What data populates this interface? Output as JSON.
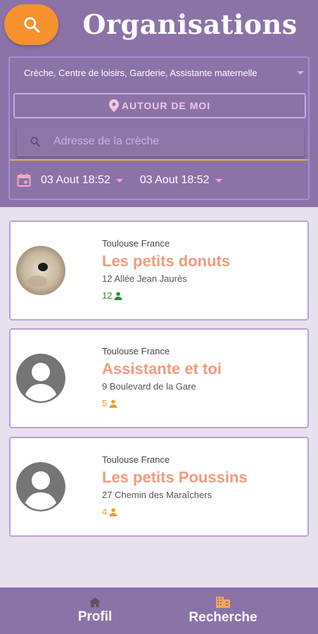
{
  "header": {
    "title": "Organisations",
    "search_icon": "search-icon"
  },
  "filters": {
    "type_value": "Crèche, Centre de loisirs, Garderie, Assistante maternelle",
    "around_me_label": "AUTOUR DE MOI",
    "address_placeholder": "Adresse de la crèche",
    "address_value": "",
    "date_from": "03 Aout 18:52",
    "date_to": "03 Aout 18:52"
  },
  "organisations": [
    {
      "city": "Toulouse France",
      "name": "Les petits donuts",
      "address": "12 Allée Jean Jaurès",
      "count": "12",
      "count_color": "#2e8b2e",
      "avatar": "photo"
    },
    {
      "city": "Toulouse France",
      "name": "Assistante et toi",
      "address": "9 Boulevard de la Gare",
      "count": "5",
      "count_color": "#f0a020",
      "avatar": "default-person"
    },
    {
      "city": "Toulouse France",
      "name": "Les petits Poussins",
      "address": "27 Chemin des Maraîchers",
      "count": "4",
      "count_color": "#f0a020",
      "avatar": "default-person"
    }
  ],
  "bottom_nav": {
    "profile_label": "Profil",
    "search_label": "Recherche",
    "active_color": "#f5a35b"
  },
  "colors": {
    "primary": "#8b73a8",
    "accent": "#f5922e",
    "org_name": "#f39a7a"
  }
}
